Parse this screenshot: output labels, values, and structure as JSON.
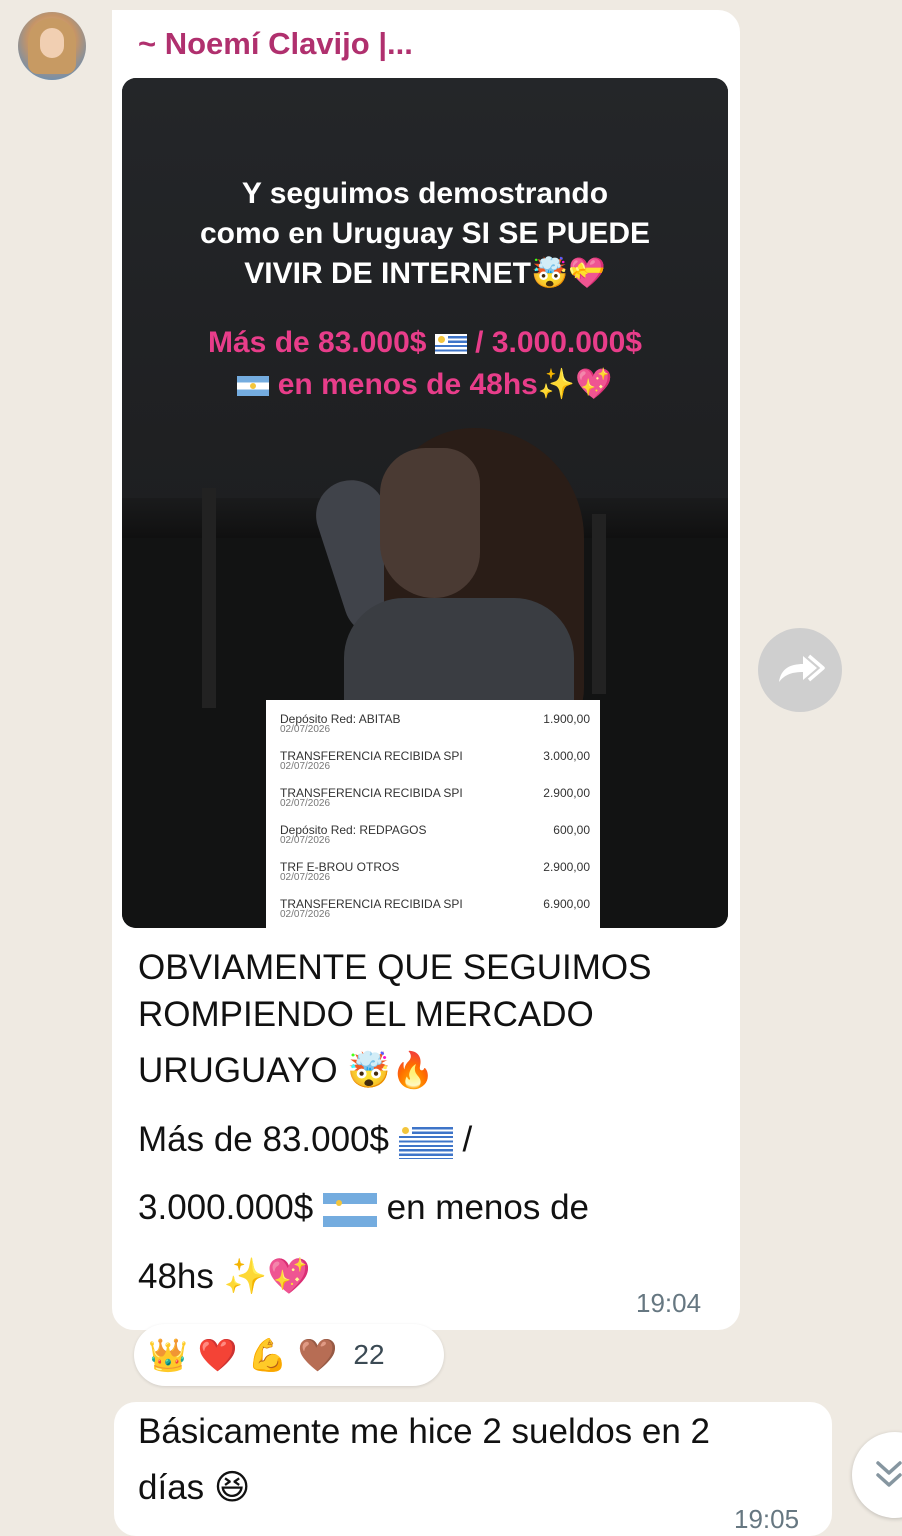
{
  "sender": {
    "name": "~ Noemí Clavijo |..."
  },
  "media": {
    "headline_lines": [
      "Y seguimos demostrando",
      "como en Uruguay SI SE PUEDE",
      "VIVIR DE INTERNET"
    ],
    "headline_emoji": "🤯💝",
    "pink_line1_a": "Más de 83.000$",
    "pink_line1_b": "/ 3.000.000$",
    "pink_line2": "en menos de 48hs",
    "pink_line2_emoji": "✨💖",
    "statement": [
      {
        "desc": "Depósito Red: ABITAB",
        "date": "02/07/2026",
        "amount": "1.900,00"
      },
      {
        "desc": "TRANSFERENCIA RECIBIDA SPI",
        "date": "02/07/2026",
        "amount": "3.000,00"
      },
      {
        "desc": "TRANSFERENCIA RECIBIDA SPI",
        "date": "02/07/2026",
        "amount": "2.900,00"
      },
      {
        "desc": "Depósito Red: REDPAGOS",
        "date": "02/07/2026",
        "amount": "600,00"
      },
      {
        "desc": "TRF E-BROU OTROS",
        "date": "02/07/2026",
        "amount": "2.900,00"
      },
      {
        "desc": "TRANSFERENCIA RECIBIDA SPI",
        "date": "02/07/2026",
        "amount": "6.900,00"
      }
    ]
  },
  "caption": {
    "line1": "OBVIAMENTE QUE SEGUIMOS",
    "line2": "ROMPIENDO EL MERCADO",
    "line3": "URUGUAYO",
    "line3_emoji": "🤯🔥",
    "line4_a": "Más de 83.000$",
    "line4_b": "/",
    "line5_a": "3.000.000$",
    "line5_b": "en menos de",
    "line6": "48hs",
    "line6_emoji": "✨💖"
  },
  "message1_time": "19:04",
  "reactions": {
    "emojis": [
      "👑",
      "❤️",
      "💪",
      "🤎"
    ],
    "count": "22"
  },
  "message2": {
    "line1": "Básicamente me hice 2 sueldos en 2",
    "line2": "días",
    "emoji": "😆",
    "time": "19:05"
  },
  "icons": {
    "forward": "forward-icon",
    "scroll": "double-chevron-down-icon"
  }
}
